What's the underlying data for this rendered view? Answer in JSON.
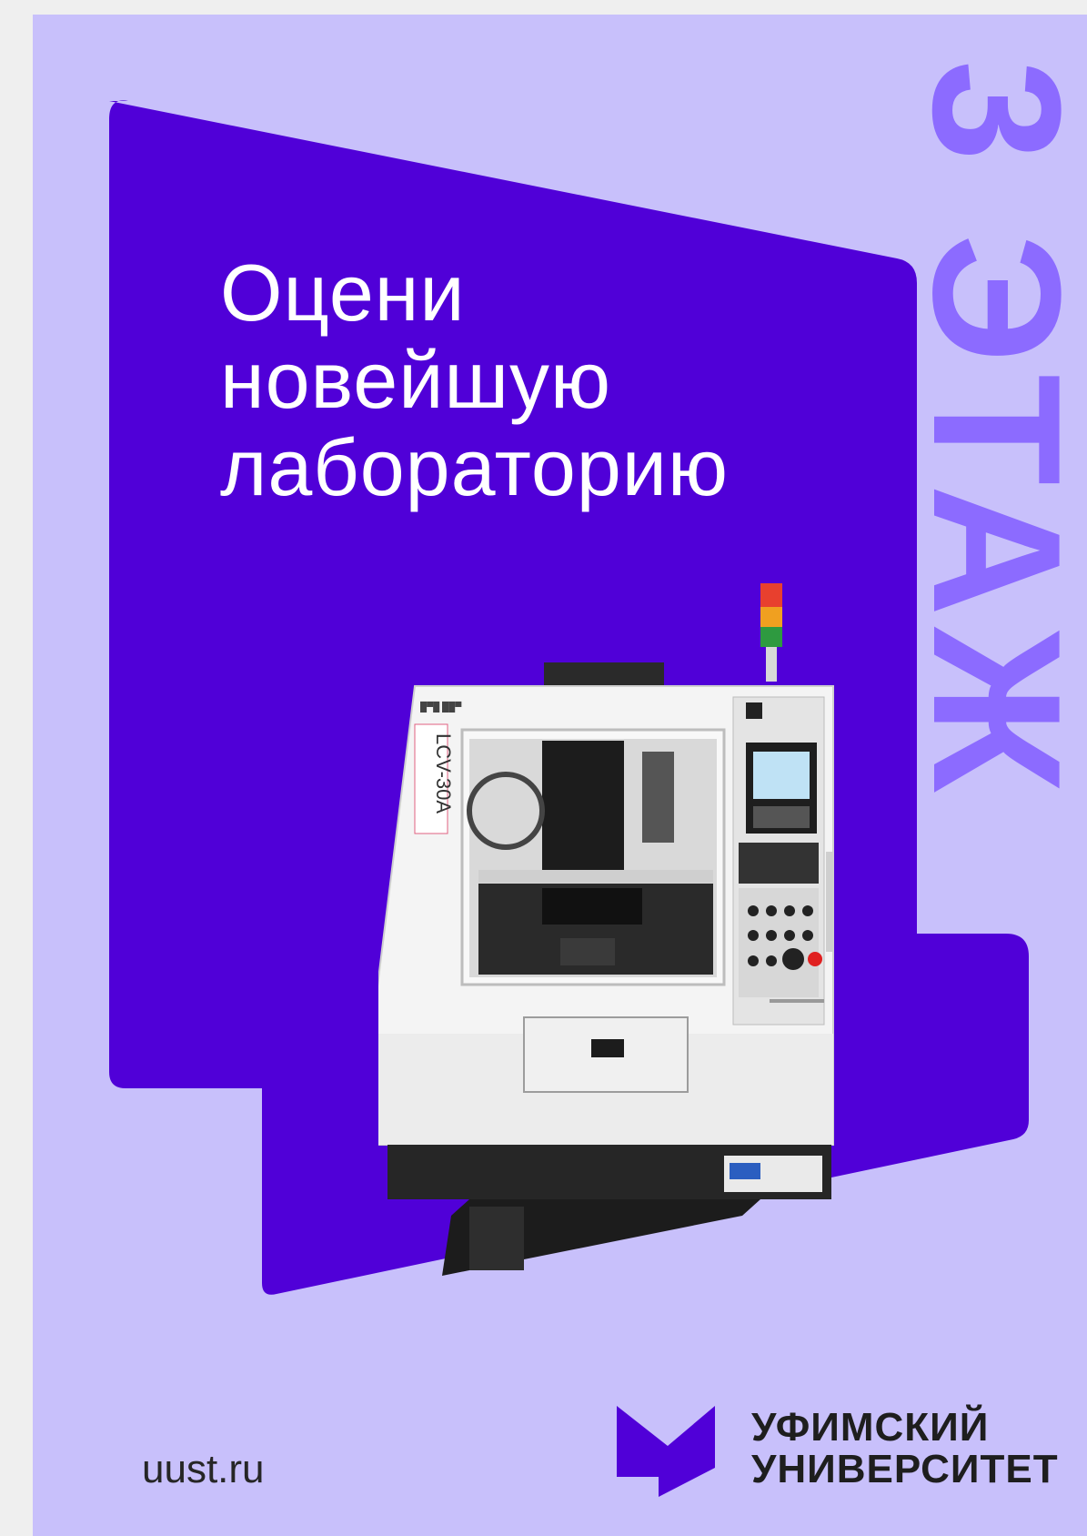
{
  "headline": {
    "line1": "Оцени",
    "line2": "новейшую",
    "line3": "лабораторию"
  },
  "floor_label": "3 ЭТАЖ",
  "site_url": "uust.ru",
  "logo": {
    "line1": "УФИМСКИЙ",
    "line2": "УНИВЕРСИТЕТ"
  },
  "machine": {
    "model_label": "LCV-30A",
    "icon": "cnc-machine-icon"
  },
  "colors": {
    "background": "#c8c0fb",
    "shape": "#5000d8",
    "floor_text": "#8c6bff",
    "headline": "#ffffff"
  }
}
